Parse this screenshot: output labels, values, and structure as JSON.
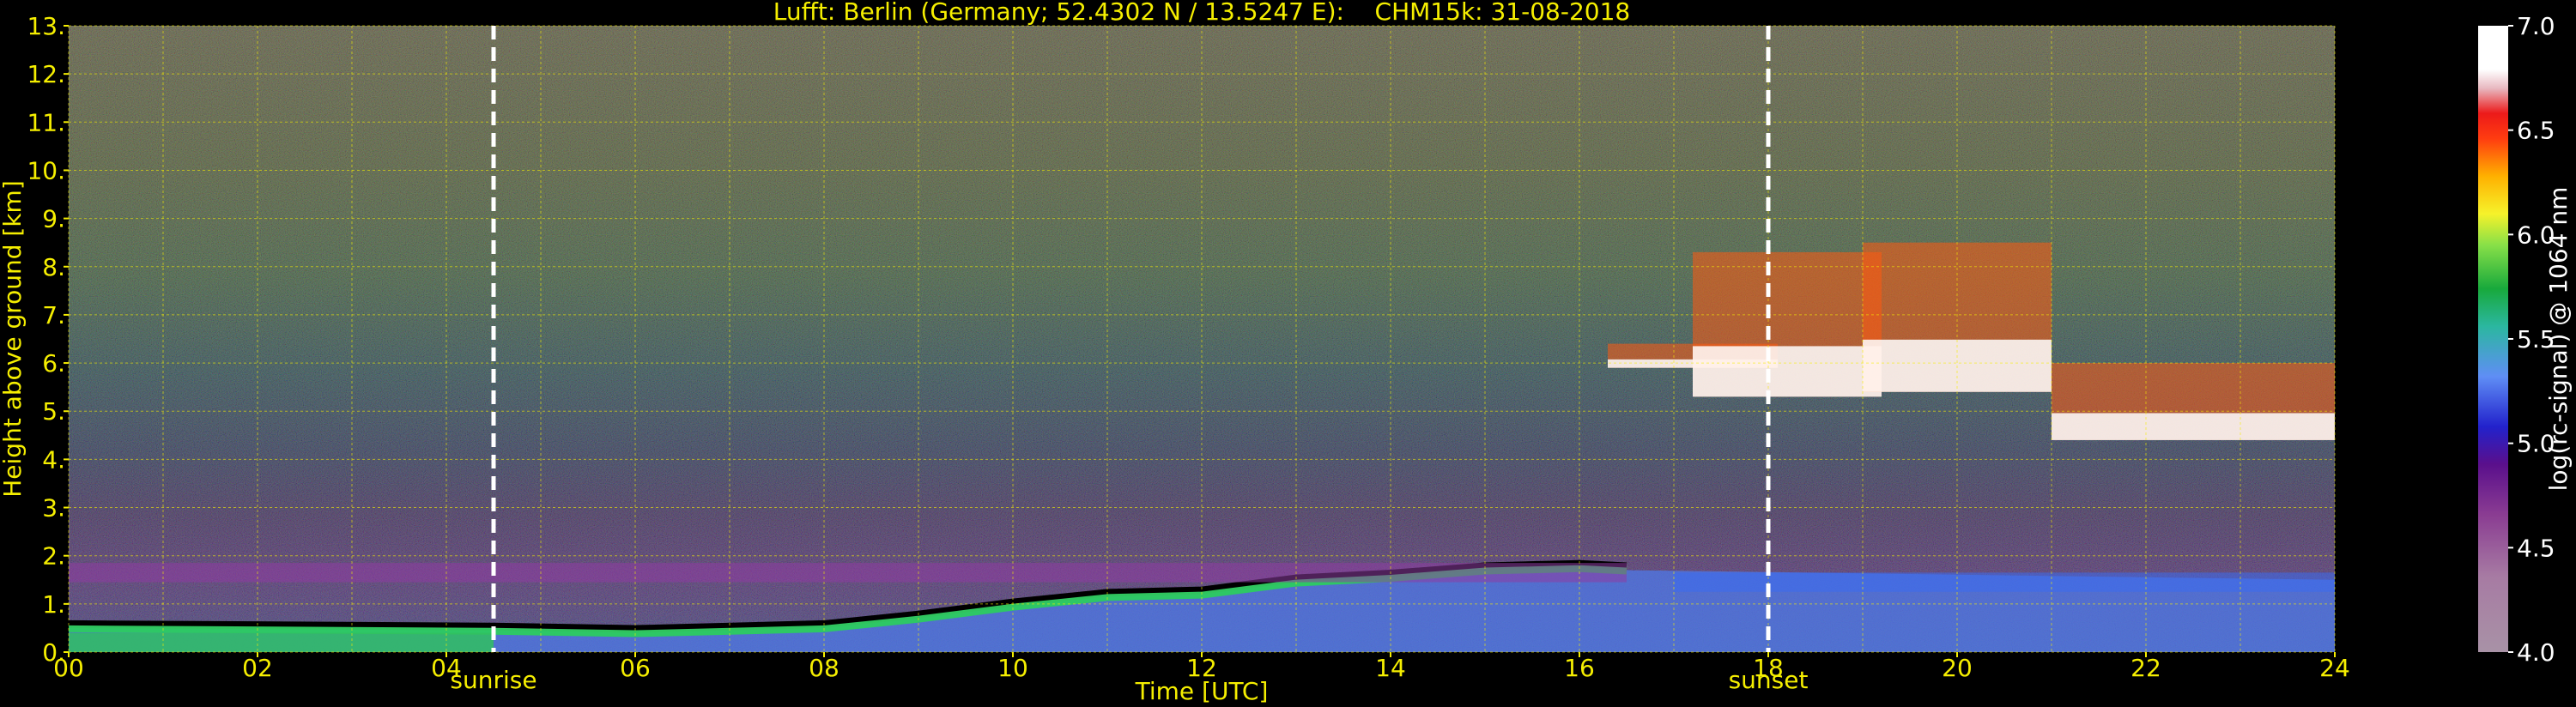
{
  "chart_data": {
    "type": "heatmap",
    "title": "Lufft: Berlin (Germany; 52.4302 N / 13.5247 E):    CHM15k: 31-08-2018",
    "xlabel": "Time [UTC]",
    "ylabel": "Height above ground [km]",
    "xlim": [
      0,
      24
    ],
    "ylim": [
      0,
      13
    ],
    "x_ticks": [
      "00",
      "02",
      "04",
      "06",
      "08",
      "10",
      "12",
      "14",
      "16",
      "18",
      "20",
      "22",
      "24"
    ],
    "y_ticks": [
      "0.",
      "1.",
      "2.",
      "3.",
      "4.",
      "5.",
      "6.",
      "7.",
      "8.",
      "9.",
      "10.",
      "11.",
      "12.",
      "13."
    ],
    "grid": true,
    "grid_color": "#f5ee00",
    "events": [
      {
        "label": "sunrise",
        "time": 4.5
      },
      {
        "label": "sunset",
        "time": 18.0
      }
    ],
    "colorbar": {
      "label": "log(rc-signal) @ 1064 nm",
      "range": [
        4.0,
        7.0
      ],
      "ticks": [
        "4.0",
        "4.5",
        "5.0",
        "5.5",
        "6.0",
        "6.5",
        "7.0"
      ]
    },
    "features": {
      "boundary_layer_top_km": [
        {
          "t": 0,
          "h": 0.5
        },
        {
          "t": 4.5,
          "h": 0.45
        },
        {
          "t": 6,
          "h": 0.4
        },
        {
          "t": 8,
          "h": 0.5
        },
        {
          "t": 9,
          "h": 0.7
        },
        {
          "t": 10,
          "h": 0.95
        },
        {
          "t": 11,
          "h": 1.15
        },
        {
          "t": 12,
          "h": 1.2
        },
        {
          "t": 13,
          "h": 1.45
        },
        {
          "t": 14,
          "h": 1.55
        },
        {
          "t": 15,
          "h": 1.7
        },
        {
          "t": 16,
          "h": 1.75
        },
        {
          "t": 16.5,
          "h": 1.7
        }
      ],
      "cirrus_clouds": [
        {
          "t_start": 16.3,
          "t_end": 18.1,
          "h_base": 5.9,
          "h_top": 6.4
        },
        {
          "t_start": 17.2,
          "t_end": 19.2,
          "h_base": 5.3,
          "h_top": 8.3
        },
        {
          "t_start": 19.0,
          "t_end": 21.0,
          "h_base": 5.4,
          "h_top": 8.5
        },
        {
          "t_start": 21.0,
          "t_end": 24.0,
          "h_base": 4.4,
          "h_top": 6.0
        }
      ],
      "residual_layer_km": [
        {
          "t_start": 0,
          "t_end": 16.5,
          "h": 1.7
        },
        {
          "t_start": 17.0,
          "t_end": 24.0,
          "h": 1.5
        }
      ]
    }
  }
}
